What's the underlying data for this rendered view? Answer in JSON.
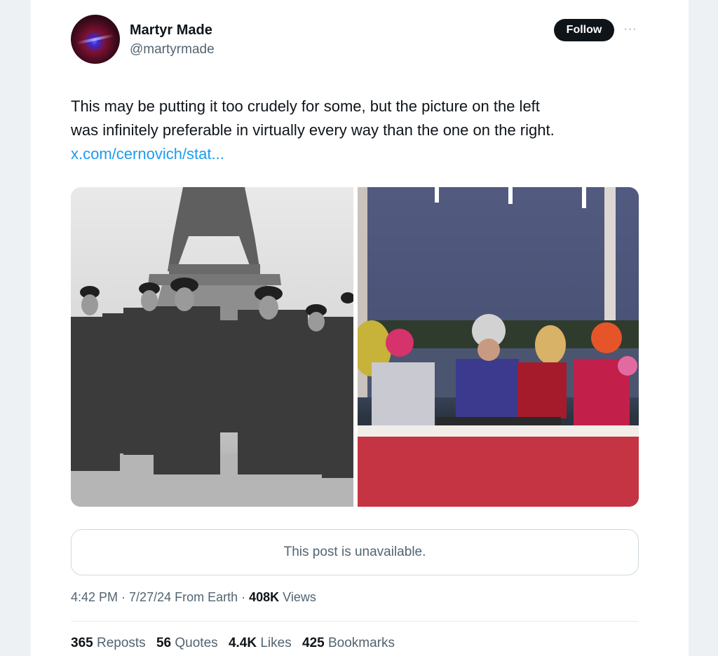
{
  "author": {
    "display_name": "Martyr Made",
    "handle": "@martyrmade"
  },
  "actions": {
    "follow_label": "Follow",
    "more_label": "···"
  },
  "post": {
    "text_line1": "This may be putting it too crudely for some, but the picture on the left",
    "text_line2": "was infinitely preferable in virtually every way than the one on the right.",
    "link_text": "x.com/cernovich/stat..."
  },
  "media": {
    "left_image": "black-and-white photo of uniformed officers in long coats walking before the Eiffel Tower",
    "right_image": "color photo of costumed performers seated behind a long red table, river and trees behind"
  },
  "quoted": {
    "unavailable_text": "This post is unavailable."
  },
  "meta": {
    "time": "4:42 PM",
    "sep1": " · ",
    "date": "7/27/24",
    "source": " From Earth",
    "sep2": " · ",
    "views_count": "408K",
    "views_label": " Views"
  },
  "stats": [
    {
      "count": "365",
      "label": " Reposts"
    },
    {
      "count": "56",
      "label": " Quotes"
    },
    {
      "count": "4.4K",
      "label": " Likes"
    },
    {
      "count": "425",
      "label": " Bookmarks"
    }
  ],
  "colors": {
    "link": "#1d9bf0",
    "text_primary": "#0f1419",
    "text_secondary": "#536471",
    "follow_bg": "#0f1419"
  }
}
